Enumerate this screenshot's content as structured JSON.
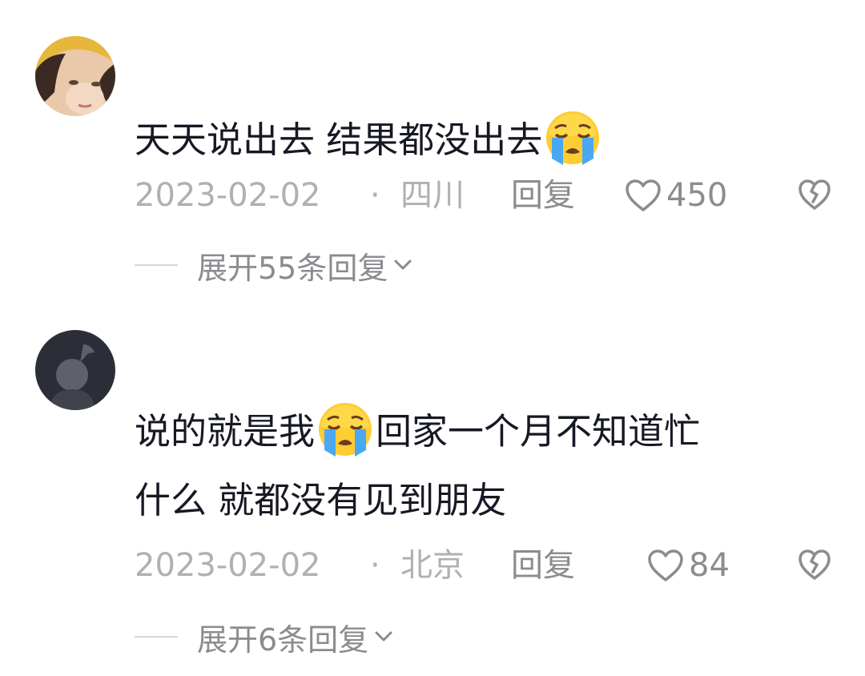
{
  "comments": [
    {
      "avatar_icon": "user-photo-avatar",
      "text_before_emoji": "天天说出去 结果都没出去",
      "emoji": "loudly-crying-face",
      "text_after_emoji": "",
      "date": "2023-02-02",
      "separator": "·",
      "location": "四川",
      "reply_label": "回复",
      "like_count": "450",
      "expand_label": "展开55条回复"
    },
    {
      "avatar_icon": "default-avatar",
      "text_before_emoji": "说的就是我",
      "emoji": "loudly-crying-face",
      "text_after_emoji": "回家一个月不知道忙",
      "text_line2": "什么 就都没有见到朋友",
      "date": "2023-02-02",
      "separator": "·",
      "location": "北京",
      "reply_label": "回复",
      "like_count": "84",
      "expand_label": "展开6条回复"
    }
  ],
  "colors": {
    "text": "#161823",
    "meta": "#b0b0b4",
    "action": "#8b8b90",
    "divider": "#d6d6d9"
  }
}
